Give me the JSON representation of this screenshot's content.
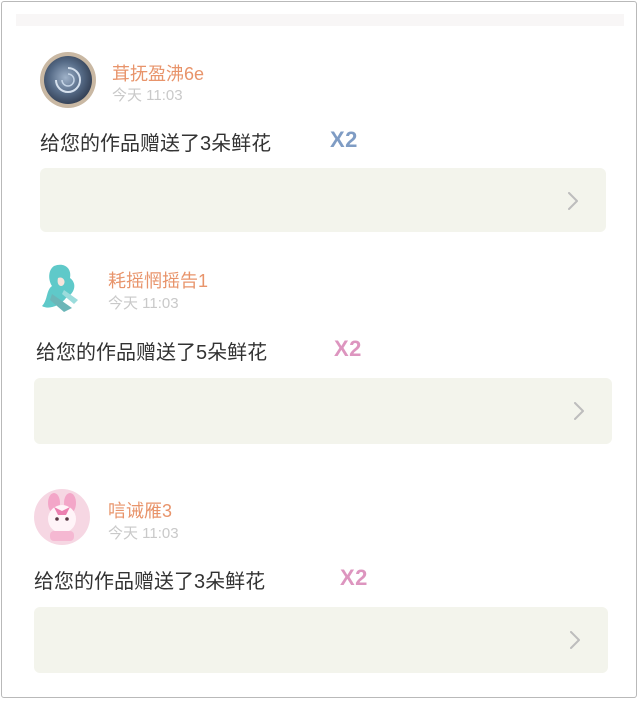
{
  "posts": [
    {
      "username": "茸抚盈沸6e",
      "time": "今天 11:03",
      "message": "给您的作品赠送了3朵鲜花",
      "multiplier": "X2",
      "multiplier_color": "#7f9cc4",
      "avatar": "sea-snail-avatar"
    },
    {
      "username": "耗摇惘摇告1",
      "time": "今天 11:03",
      "message": "给您的作品赠送了5朵鲜花",
      "multiplier": "X2",
      "multiplier_color": "#dd95bf",
      "avatar": "anime-girl-avatar"
    },
    {
      "username": "唁诫雁3",
      "time": "今天 11:03",
      "message": "给您的作品赠送了3朵鲜花",
      "multiplier": "X2",
      "multiplier_color": "#dd95bf",
      "avatar": "pink-bunny-avatar"
    }
  ],
  "colors": {
    "username": "#e8946b",
    "time": "#c9c9c9",
    "work_card_bg": "#f3f4ec",
    "chevron": "#bdbdbd"
  },
  "icons": [
    "chevron-right-icon"
  ]
}
